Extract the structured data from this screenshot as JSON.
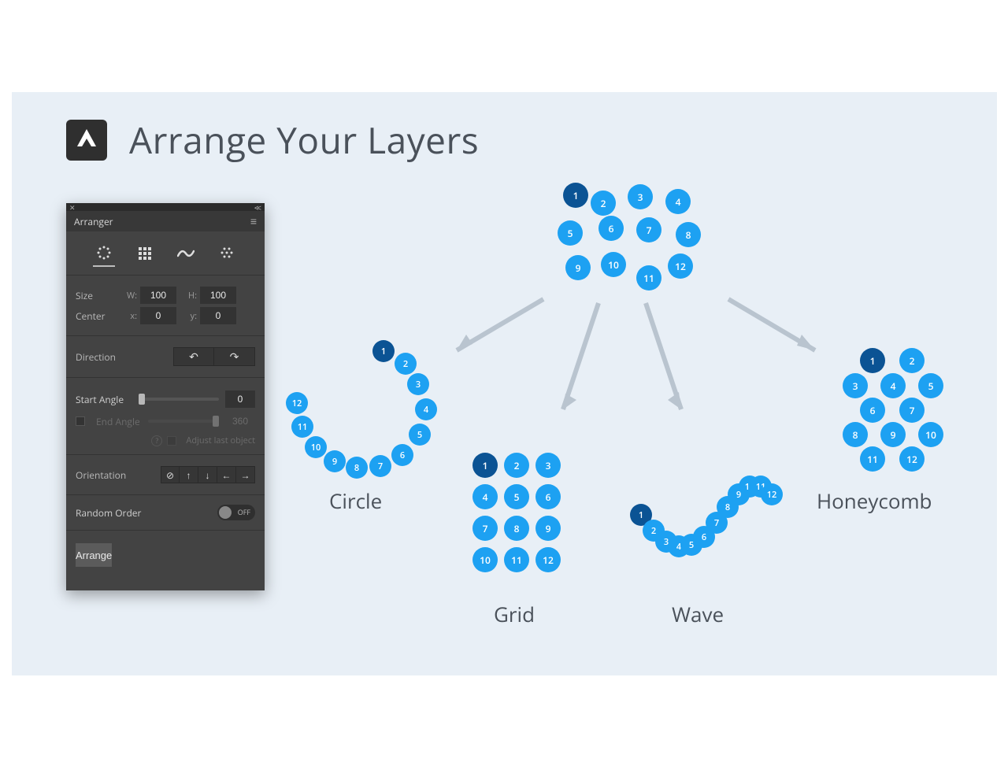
{
  "title": "Arrange Your Layers",
  "panel": {
    "name": "Arranger",
    "modes": [
      "circle",
      "grid",
      "wave",
      "honeycomb"
    ],
    "active_mode": "circle",
    "size": {
      "label": "Size",
      "w_label": "W:",
      "w": "100",
      "h_label": "H:",
      "h": "100"
    },
    "center": {
      "label": "Center",
      "x_label": "x:",
      "x": "0",
      "y_label": "y:",
      "y": "0"
    },
    "direction": {
      "label": "Direction"
    },
    "start_angle": {
      "label": "Start Angle",
      "value": "0"
    },
    "end_angle": {
      "label": "End Angle",
      "value": "360",
      "checked": false
    },
    "adjust_last": "Adjust last object",
    "orientation": {
      "label": "Orientation"
    },
    "random_order": {
      "label": "Random Order",
      "state": "OFF"
    },
    "arrange": "Arrange"
  },
  "captions": {
    "circle": "Circle",
    "grid": "Grid",
    "wave": "Wave",
    "honeycomb": "Honeycomb"
  },
  "dot_labels": [
    "1",
    "2",
    "3",
    "4",
    "5",
    "6",
    "7",
    "8",
    "9",
    "10",
    "11",
    "12"
  ]
}
